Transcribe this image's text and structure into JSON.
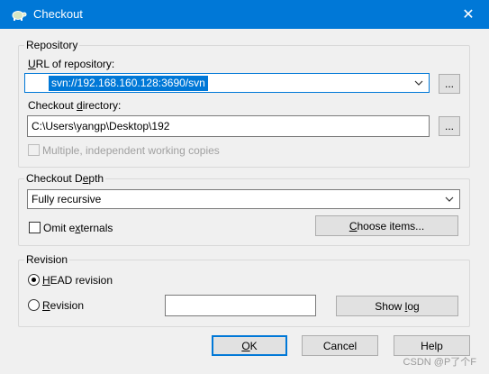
{
  "window": {
    "title": "Checkout",
    "close_label": "✕"
  },
  "repository": {
    "group_label": "Repository",
    "url_label_prefix": "",
    "url_label_u": "U",
    "url_label_rest": "RL of repository:",
    "url_value": "svn://192.168.160.128:3690/svn",
    "url_browse_label": "...",
    "dir_label_prefix": "Checkout ",
    "dir_label_u": "d",
    "dir_label_rest": "irectory:",
    "dir_value": "C:\\Users\\yangp\\Desktop\\192",
    "dir_browse_label": "...",
    "multiple_label": "Multiple, independent working copies"
  },
  "depth": {
    "group_label_prefix": "Checkout D",
    "group_label_u": "e",
    "group_label_rest": "pth",
    "selected": "Fully recursive",
    "omit_prefix": "Omit e",
    "omit_u": "x",
    "omit_rest": "ternals",
    "choose_prefix": "",
    "choose_u": "C",
    "choose_rest": "hoose items..."
  },
  "revision": {
    "group_label": "Revision",
    "head_u": "H",
    "head_rest": "EAD revision",
    "rev_u": "R",
    "rev_rest": "evision",
    "rev_value": "",
    "showlog_prefix": "Show ",
    "showlog_u": "l",
    "showlog_rest": "og"
  },
  "buttons": {
    "ok_u": "O",
    "ok_rest": "K",
    "cancel": "Cancel",
    "help": "Help"
  },
  "watermark": "CSDN @P了个F"
}
